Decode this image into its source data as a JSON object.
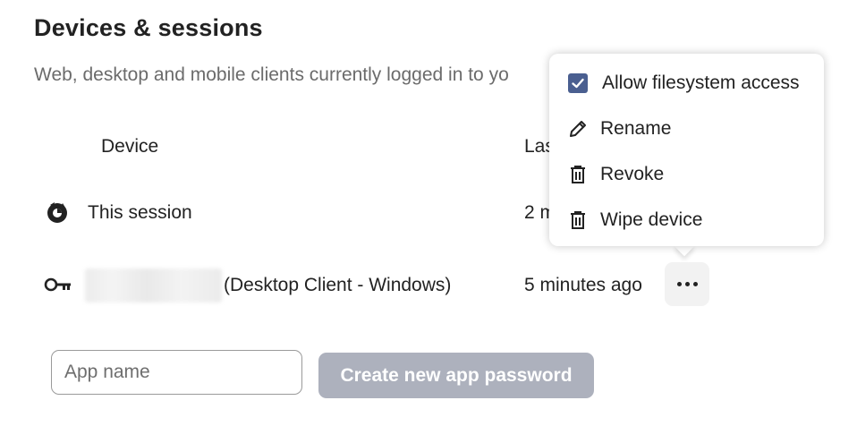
{
  "header": {
    "title": "Devices & sessions",
    "description": "Web, desktop and mobile clients currently logged in to yo"
  },
  "table": {
    "columns": [
      "Device",
      "Las"
    ],
    "rows": [
      {
        "icon": "browser-session-icon",
        "device": "This session",
        "last_activity": "2 m"
      },
      {
        "icon": "key-icon",
        "device": "(Desktop Client - Windows)",
        "last_activity": "5 minutes ago"
      }
    ]
  },
  "menu": {
    "items": [
      {
        "icon": "checkbox-checked-icon",
        "label": "Allow filesystem access",
        "checked": true
      },
      {
        "icon": "pencil-icon",
        "label": "Rename"
      },
      {
        "icon": "trash-icon",
        "label": "Revoke"
      },
      {
        "icon": "trash-icon",
        "label": "Wipe device"
      }
    ]
  },
  "app_password": {
    "placeholder": "App name",
    "value": "",
    "button_label": "Create new app password"
  },
  "colors": {
    "checkbox": "#4a5f90",
    "button_disabled": "#adb1bd",
    "muted_text": "#6b6b6b"
  }
}
